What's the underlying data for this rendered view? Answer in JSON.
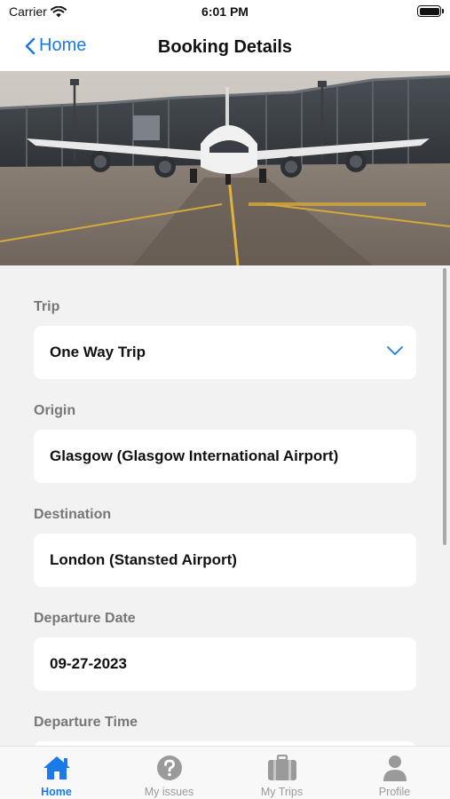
{
  "status_bar": {
    "carrier": "Carrier",
    "time": "6:01 PM"
  },
  "nav": {
    "back_label": "Home",
    "title": "Booking Details"
  },
  "hero": {
    "icon": "airplane-photo"
  },
  "form": {
    "trip": {
      "label": "Trip",
      "value": "One Way Trip"
    },
    "origin": {
      "label": "Origin",
      "value": "Glasgow (Glasgow International Airport)"
    },
    "destination": {
      "label": "Destination",
      "value": "London (Stansted Airport)"
    },
    "departure_date": {
      "label": "Departure Date",
      "value": "09-27-2023"
    },
    "departure_time": {
      "label": "Departure Time",
      "value": ""
    }
  },
  "tabs": [
    {
      "label": "Home",
      "icon": "home-icon",
      "active": true
    },
    {
      "label": "My issues",
      "icon": "question-icon",
      "active": false
    },
    {
      "label": "My Trips",
      "icon": "luggage-icon",
      "active": false
    },
    {
      "label": "Profile",
      "icon": "person-icon",
      "active": false
    }
  ],
  "colors": {
    "accent": "#1a7ae8",
    "inactive": "#9a9a9a",
    "background": "#f2f2f2"
  }
}
